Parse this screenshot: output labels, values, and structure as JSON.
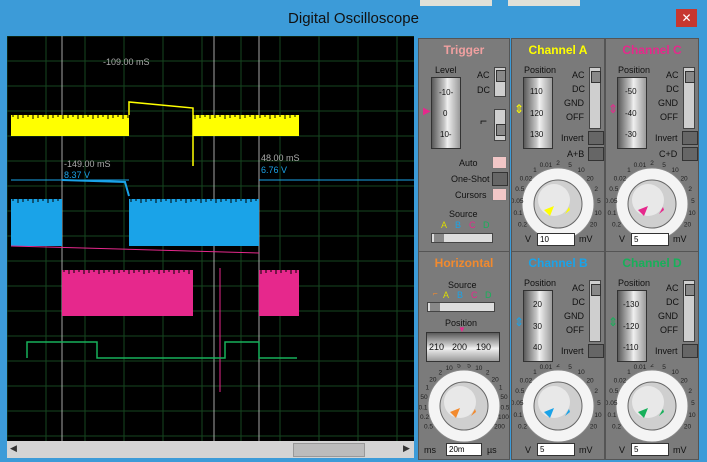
{
  "window": {
    "title": "Digital Oscilloscope",
    "close_glyph": "✕",
    "background_tabs": [
      {
        "label": "Channel A",
        "color": "#f5f5a0"
      },
      {
        "label": "Channel C",
        "color": "#f3b3c9"
      }
    ]
  },
  "screen": {
    "cursor_top_label": "-109.00 mS",
    "cursor_left_time": "-149.00 mS",
    "cursor_left_volt": "8.37 V",
    "cursor_right_time": "48.00 mS",
    "cursor_right_volt": "6.76 V",
    "colors": {
      "a": "#ffff00",
      "b": "#1aa3e8",
      "c": "#e6288c",
      "d": "#17b05a",
      "grid": "#16461f",
      "cursor": "#cccccc"
    }
  },
  "scrollbar": {
    "left_arrow": "◀",
    "right_arrow": "▶"
  },
  "trigger": {
    "title": "Trigger",
    "level_label": "Level",
    "ac": "AC",
    "dc": "DC",
    "ticks": [
      "-10-",
      "0",
      "10-"
    ],
    "auto": "Auto",
    "one_shot": "One-Shot",
    "cursors": "Cursors",
    "source_label": "Source",
    "sources": [
      "A",
      "B",
      "C",
      "D"
    ]
  },
  "channel_a": {
    "title": "Channel A",
    "position_label": "Position",
    "ticks": [
      "110",
      "120",
      "130"
    ],
    "modes": [
      "AC",
      "DC",
      "GND",
      "OFF"
    ],
    "invert": "Invert",
    "combine": "A+B",
    "knob_scale": [
      "0.2",
      "0.1",
      "0.05",
      "0.5",
      "0.02",
      "1",
      "0.01",
      "2",
      "5",
      "10",
      "20",
      "2",
      "5",
      "10",
      "20"
    ],
    "unit_left": "V",
    "value": "10",
    "unit_right": "mV",
    "color": "#ffff00"
  },
  "channel_c": {
    "title": "Channel C",
    "position_label": "Position",
    "ticks": [
      "-50",
      "-40",
      "-30"
    ],
    "modes": [
      "AC",
      "DC",
      "GND",
      "OFF"
    ],
    "invert": "Invert",
    "combine": "C+D",
    "knob_scale": [
      "0.2",
      "0.1",
      "0.05",
      "0.5",
      "0.02",
      "1",
      "0.01",
      "2",
      "5",
      "10",
      "20",
      "2",
      "5",
      "10",
      "20"
    ],
    "unit_left": "V",
    "value": "5",
    "unit_right": "mV",
    "color": "#e6288c"
  },
  "channel_b": {
    "title": "Channel B",
    "position_label": "Position",
    "ticks": [
      "20",
      "30",
      "40"
    ],
    "modes": [
      "AC",
      "DC",
      "GND",
      "OFF"
    ],
    "invert": "Invert",
    "knob_scale": [
      "0.2",
      "0.1",
      "0.05",
      "0.5",
      "0.02",
      "1",
      "0.01",
      "2",
      "5",
      "10",
      "20",
      "2",
      "5",
      "10",
      "20"
    ],
    "unit_left": "V",
    "value": "5",
    "unit_right": "mV",
    "color": "#1aa3e8"
  },
  "channel_d": {
    "title": "Channel D",
    "position_label": "Position",
    "ticks": [
      "-130",
      "-120",
      "-110"
    ],
    "modes": [
      "AC",
      "DC",
      "GND",
      "OFF"
    ],
    "invert": "Invert",
    "knob_scale": [
      "0.2",
      "0.1",
      "0.05",
      "0.5",
      "0.02",
      "1",
      "0.01",
      "2",
      "5",
      "10",
      "20",
      "2",
      "5",
      "10",
      "20"
    ],
    "unit_left": "V",
    "value": "5",
    "unit_right": "mV",
    "color": "#17b05a"
  },
  "horizontal": {
    "title": "Horizontal",
    "source_label": "Source",
    "sources": [
      "A",
      "B",
      "C",
      "D"
    ],
    "position_label": "Position",
    "ticks": [
      "210",
      "200",
      "190"
    ],
    "knob_scale": [
      "0.5",
      "0.2",
      "0.1",
      "50",
      "1",
      "20",
      "2",
      "10",
      "5",
      "5",
      "10",
      "2",
      "20",
      "1",
      "50",
      "0.5",
      "100",
      "200"
    ],
    "unit_left": "ms",
    "value": "20m",
    "unit_right": "µs",
    "color": "#f28a2e"
  }
}
